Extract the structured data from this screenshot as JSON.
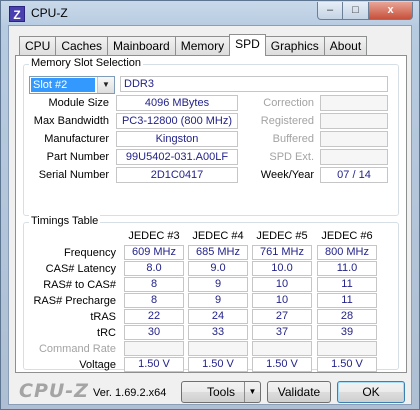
{
  "window": {
    "title": "CPU-Z",
    "app_icon_letter": "Z",
    "controls": {
      "minimize": "–",
      "maximize": "□",
      "close": "x"
    }
  },
  "tabs": [
    {
      "label": "CPU"
    },
    {
      "label": "Caches"
    },
    {
      "label": "Mainboard"
    },
    {
      "label": "Memory"
    },
    {
      "label": "SPD",
      "active": true
    },
    {
      "label": "Graphics"
    },
    {
      "label": "About"
    }
  ],
  "memory_slot": {
    "group_title": "Memory Slot Selection",
    "slot_selected": "Slot #2",
    "type": "DDR3",
    "module_size_label": "Module Size",
    "module_size": "4096 MBytes",
    "max_bandwidth_label": "Max Bandwidth",
    "max_bandwidth": "PC3-12800 (800 MHz)",
    "manufacturer_label": "Manufacturer",
    "manufacturer": "Kingston",
    "part_number_label": "Part Number",
    "part_number": "99U5402-031.A00LF",
    "serial_number_label": "Serial Number",
    "serial_number": "2D1C0417",
    "correction_label": "Correction",
    "registered_label": "Registered",
    "buffered_label": "Buffered",
    "spd_ext_label": "SPD Ext.",
    "week_year_label": "Week/Year",
    "week_year": "07 / 14"
  },
  "timings": {
    "group_title": "Timings Table",
    "columns": [
      "JEDEC #3",
      "JEDEC #4",
      "JEDEC #5",
      "JEDEC #6"
    ],
    "row_labels": {
      "frequency": "Frequency",
      "cas_latency": "CAS# Latency",
      "ras_to_cas": "RAS# to CAS#",
      "ras_precharge": "RAS# Precharge",
      "tras": "tRAS",
      "trc": "tRC",
      "command_rate": "Command Rate",
      "voltage": "Voltage"
    },
    "values": {
      "frequency": [
        "609 MHz",
        "685 MHz",
        "761 MHz",
        "800 MHz"
      ],
      "cas_latency": [
        "8.0",
        "9.0",
        "10.0",
        "11.0"
      ],
      "ras_to_cas": [
        "8",
        "9",
        "10",
        "11"
      ],
      "ras_precharge": [
        "8",
        "9",
        "10",
        "11"
      ],
      "tras": [
        "22",
        "24",
        "27",
        "28"
      ],
      "trc": [
        "30",
        "33",
        "37",
        "39"
      ],
      "command_rate": [
        "",
        "",
        "",
        ""
      ],
      "voltage": [
        "1.50 V",
        "1.50 V",
        "1.50 V",
        "1.50 V"
      ]
    }
  },
  "footer": {
    "brand": "CPU-Z",
    "version": "Ver. 1.69.2.x64",
    "tools_label": "Tools",
    "validate_label": "Validate",
    "ok_label": "OK"
  }
}
